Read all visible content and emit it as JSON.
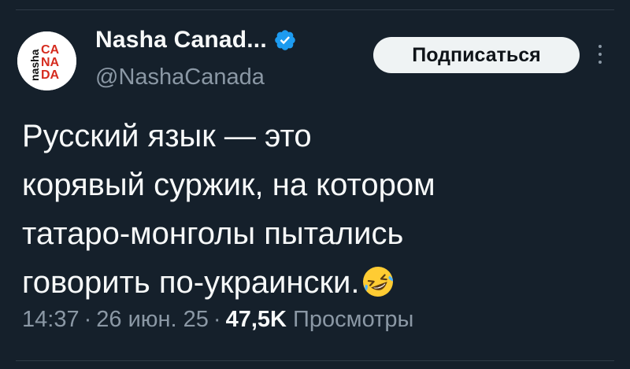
{
  "author": {
    "display_name": "Nasha Canad...",
    "handle": "@NashaCanada",
    "avatar_text_left": "nasha",
    "avatar_text_lines": [
      "CA",
      "NA",
      "DA"
    ],
    "verified": true
  },
  "follow_button": {
    "label": "Подписаться"
  },
  "tweet": {
    "lines": [
      "Русский язык — это",
      "корявый суржик, на котором",
      "татаро-монголы пытались",
      "говорить по-украински."
    ],
    "emoji": "rolling-on-the-floor-laughing"
  },
  "meta": {
    "time": "14:37",
    "separator": "·",
    "date": "26 июн. 25",
    "views_count": "47,5K",
    "views_label": "Просмотры"
  },
  "colors": {
    "background": "#15202b",
    "text": "#f7f9f9",
    "secondary_text": "#8b98a5",
    "verified_blue": "#1d9bf0",
    "avatar_red": "#d52b1e"
  }
}
